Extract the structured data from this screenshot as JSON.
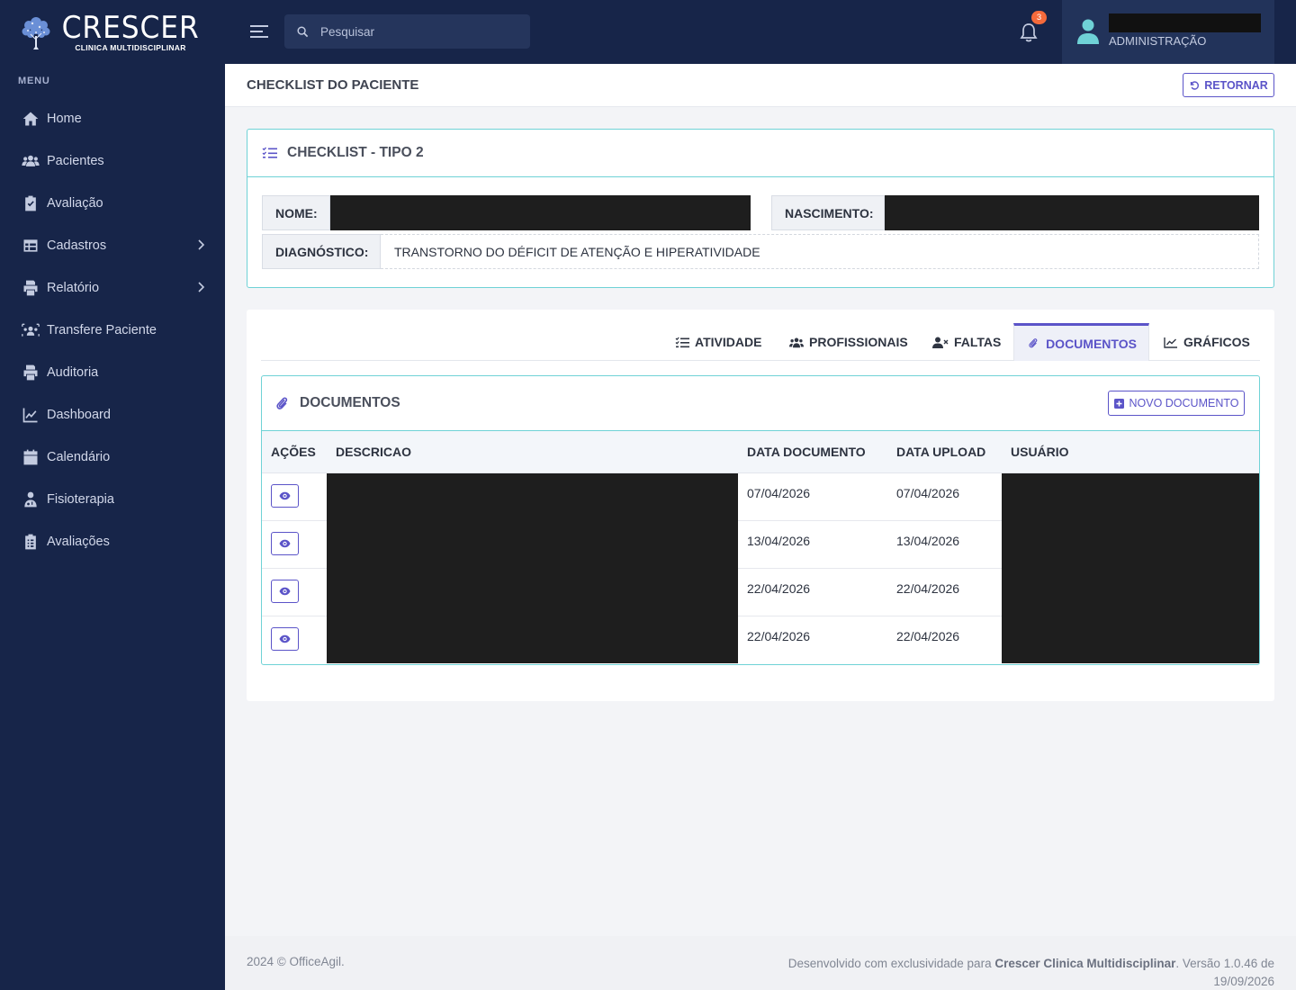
{
  "brand": {
    "logo_main": "CRESCER",
    "logo_sub": "CLINICA MULTIDISCIPLINAR",
    "color_sidebar": "#172549",
    "color_accent": "#5b54c8",
    "color_border": "#6fd2d6"
  },
  "sidebar": {
    "menu_title": "MENU",
    "items": [
      {
        "label": "Home",
        "icon": "home-icon"
      },
      {
        "label": "Pacientes",
        "icon": "users-icon"
      },
      {
        "label": "Avaliação",
        "icon": "clipboard-check-icon"
      },
      {
        "label": "Cadastros",
        "icon": "table-icon",
        "has_submenu": true
      },
      {
        "label": "Relatório",
        "icon": "print-icon",
        "has_submenu": true
      },
      {
        "label": "Transfere Paciente",
        "icon": "transfer-users-icon"
      },
      {
        "label": "Auditoria",
        "icon": "print-icon"
      },
      {
        "label": "Dashboard",
        "icon": "line-chart-icon"
      },
      {
        "label": "Calendário",
        "icon": "calendar-icon"
      },
      {
        "label": "Fisioterapia",
        "icon": "physio-user-icon"
      },
      {
        "label": "Avaliações",
        "icon": "clipboard-list-icon"
      }
    ]
  },
  "topbar": {
    "search_placeholder": "Pesquisar",
    "notifications_count": "3",
    "user_role": "ADMINISTRAÇÃO"
  },
  "page": {
    "title": "CHECKLIST DO PACIENTE",
    "return_label": "RETORNAR"
  },
  "checklist": {
    "title": "CHECKLIST - TIPO 2",
    "nome_label": "NOME:",
    "nascimento_label": "NASCIMENTO:",
    "diagnostico_label": "DIAGNÓSTICO:",
    "diagnostico_value": "TRANSTORNO DO DÉFICIT DE ATENÇÃO E HIPERATIVIDADE"
  },
  "tabs": [
    {
      "label": "ATIVIDADE",
      "icon": "list-check-icon"
    },
    {
      "label": "PROFISSIONAIS",
      "icon": "users-icon"
    },
    {
      "label": "FALTAS",
      "icon": "user-x-icon"
    },
    {
      "label": "DOCUMENTOS",
      "icon": "paperclip-icon",
      "active": true
    },
    {
      "label": "GRÁFICOS",
      "icon": "line-chart-icon"
    }
  ],
  "documents": {
    "title": "DOCUMENTOS",
    "new_label": "NOVO DOCUMENTO",
    "columns": [
      "AÇÕES",
      "DESCRICAO",
      "DATA DOCUMENTO",
      "DATA UPLOAD",
      "USUÁRIO"
    ],
    "rows": [
      {
        "data_documento": "07/04/2026",
        "data_upload": "07/04/2026"
      },
      {
        "data_documento": "13/04/2026",
        "data_upload": "13/04/2026"
      },
      {
        "data_documento": "22/04/2026",
        "data_upload": "22/04/2026"
      },
      {
        "data_documento": "22/04/2026",
        "data_upload": "22/04/2026"
      }
    ]
  },
  "footer": {
    "left": "2024 © OfficeAgil.",
    "right_prefix": "Desenvolvido com exclusividade para ",
    "right_brand": "Crescer Clinica Multidisciplinar",
    "right_suffix": ". Versão 1.0.46 de 19/09/2026"
  }
}
